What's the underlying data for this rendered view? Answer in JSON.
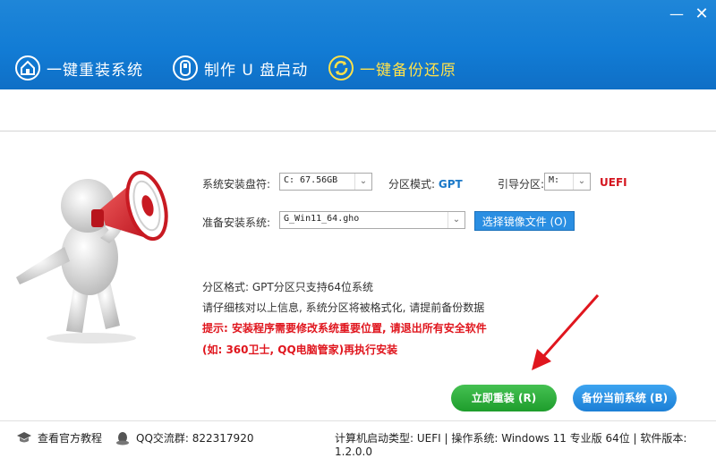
{
  "window": {
    "minimize_glyph": "—",
    "close_glyph": "✕"
  },
  "nav": [
    {
      "label": "一键重装系统",
      "icon": "house-icon"
    },
    {
      "label": "制作 U 盘启动",
      "icon": "usb-drive-icon"
    },
    {
      "label": "一键备份还原",
      "icon": "backup-restore-icon",
      "active": true
    }
  ],
  "form": {
    "install_disk_label": "系统安装盘符:",
    "install_disk_value": "C: 67.56GB",
    "partition_mode_label": "分区模式:",
    "partition_mode_value": "GPT",
    "boot_partition_label": "引导分区:",
    "boot_partition_value": "M:",
    "boot_mode_value": "UEFI",
    "prepare_system_label": "准备安装系统:",
    "prepare_system_value": "G_Win11_64.gho",
    "choose_image_button": "选择镜像文件 (O)"
  },
  "info": {
    "line1": "分区格式: GPT分区只支持64位系统",
    "line2": "请仔细核对以上信息, 系统分区将被格式化, 请提前备份数据",
    "line3": "提示: 安装程序需要修改系统重要位置, 请退出所有安全软件",
    "line4": "(如: 360卫士, QQ电脑管家)再执行安装"
  },
  "buttons": {
    "install_now": "立即重装 (R)",
    "backup_current": "备份当前系统 (B)"
  },
  "footer": {
    "tutorial": "查看官方教程",
    "qq_group": "QQ交流群: 822317920",
    "status": "计算机启动类型: UEFI | 操作系统: Windows 11 专业版 64位 | 软件版本: 1.2.0.0"
  },
  "colors": {
    "header_blue": "#1a80d6",
    "active_nav": "#ffe14a",
    "install_green": "#2bb03a",
    "backup_blue": "#2a8ee2",
    "warning_red": "#e0161e"
  }
}
